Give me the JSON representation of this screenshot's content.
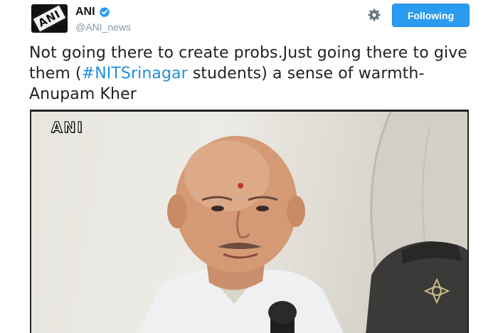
{
  "account": {
    "display_name": "ANI",
    "handle": "@ANI_news",
    "avatar_text": "ANI",
    "verified": true
  },
  "actions": {
    "settings_icon": "gear-icon",
    "follow_label": "Following"
  },
  "tweet": {
    "text_before": "Not going there to create probs.Just going there to give them (",
    "hashtag": "#NITSrinagar",
    "text_after": " students) a sense of warmth- Anupam Kher"
  },
  "media": {
    "watermark": "ANI"
  },
  "colors": {
    "accent": "#2b9bf0",
    "hashtag": "#1f8ee0",
    "handle": "#8899a6"
  }
}
